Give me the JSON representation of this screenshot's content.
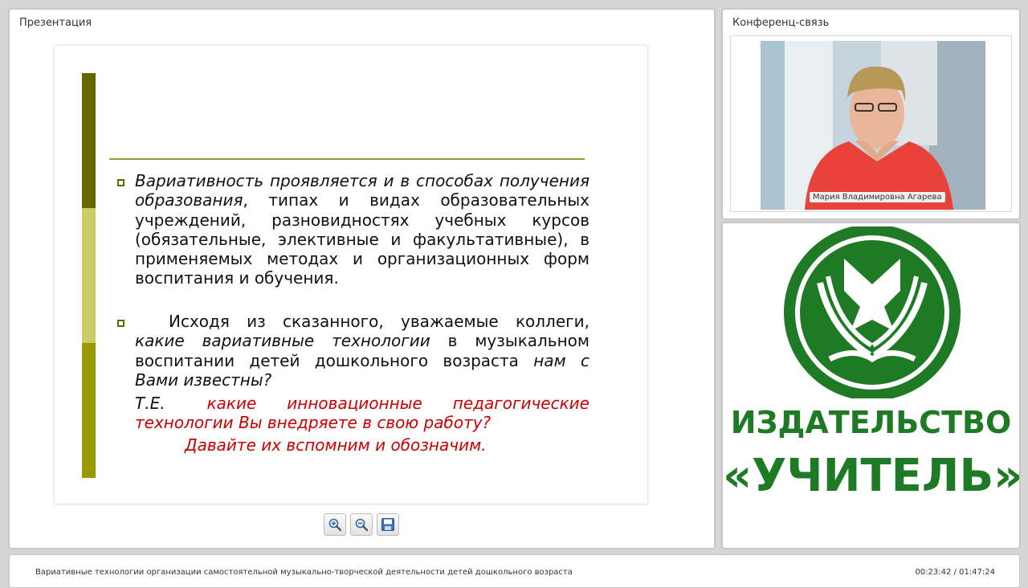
{
  "presentation": {
    "panel_title": "Презентация",
    "slide": {
      "para1_italic": "Вариативность проявляется и в способах получения образования",
      "para1_rest": ", типах и видах образовательных учреждений, разновидностях учебных курсов (обязательные, элективные и факультативные), в применяемых методах и организационных форм воспитания и обучения.",
      "para2_start": "Исходя из сказанного, уважаемые коллеги,",
      "para2_italic1": "какие вариативные технологии",
      "para2_mid": "в музыкальном воспитании детей дошкольного возраста",
      "para2_italic2": "нам с Вами известны?",
      "para3_te": "Т.Е.",
      "para3_red": "какие инновационные педагогические технологии Вы внедряете в свою работу?",
      "para4_red": "Давайте их вспомним и обозначим."
    },
    "toolbar": {
      "zoom_in": "zoom-in-icon",
      "zoom_out": "zoom-out-icon",
      "save": "save-icon"
    }
  },
  "conference": {
    "panel_title": "Конференц-связь",
    "participant_name": "Мария Владимировна Агарева"
  },
  "logo": {
    "line1": "ИЗДАТЕЛЬСТВО",
    "line2": "«УЧИТЕЛЬ»",
    "brand_color": "#1e7a24"
  },
  "footer": {
    "title": "Вариативные технологии организации самостоятельной музыкально-творческой деятельности детей дошкольного возраста",
    "time": "00:23:42 / 01:47:24"
  }
}
